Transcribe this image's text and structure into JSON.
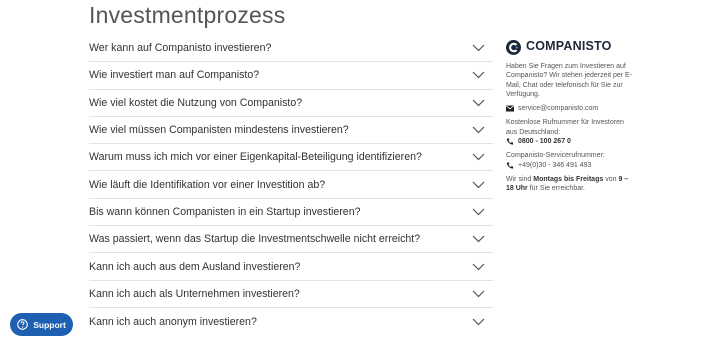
{
  "page": {
    "title": "Investmentprozess"
  },
  "faq": {
    "questions": [
      "Wer kann auf Companisto investieren?",
      "Wie investiert man auf Companisto?",
      "Wie viel kostet die Nutzung von Companisto?",
      "Wie viel müssen Companisten mindestens investieren?",
      "Warum muss ich mich vor einer Eigenkapital-Beteiligung identifizieren?",
      "Wie läuft die Identifikation vor einer Investition ab?",
      "Bis wann können Companisten in ein Startup investieren?",
      "Was passiert, wenn das Startup die Investmentschwelle nicht erreicht?",
      "Kann ich auch aus dem Ausland investieren?",
      "Kann ich auch als Unternehmen investieren?",
      "Kann ich auch anonym investieren?"
    ],
    "expand_icon": "chevron-down-icon"
  },
  "contact": {
    "brand": "COMPANISTO",
    "intro": "Haben Sie Fragen zum Investieren auf Companisto? Wir stehen jederzeit per E-Mail, Chat oder telefonisch für Sie zur Verfügung.",
    "email": "service@companisto.com",
    "free_label": "Kostenlose Rufnummer für Investoren aus Deutschland:",
    "free_number": "0800 - 100 267 0",
    "service_label": "Companisto-Servicerufnummer:",
    "service_number": "+49(0)30 - 346 491 493",
    "hours_pre": "Wir sind ",
    "hours_days": "Montags bis Freitags",
    "hours_mid": " von ",
    "hours_time": "9 – 18 Uhr",
    "hours_post": " für Sie erreichbar."
  },
  "support": {
    "label": "Support",
    "icon": "help-circle-icon"
  },
  "colors": {
    "support_bg": "#1d5fb0",
    "brand_text": "#1e2838",
    "divider": "#e2e2e2"
  }
}
